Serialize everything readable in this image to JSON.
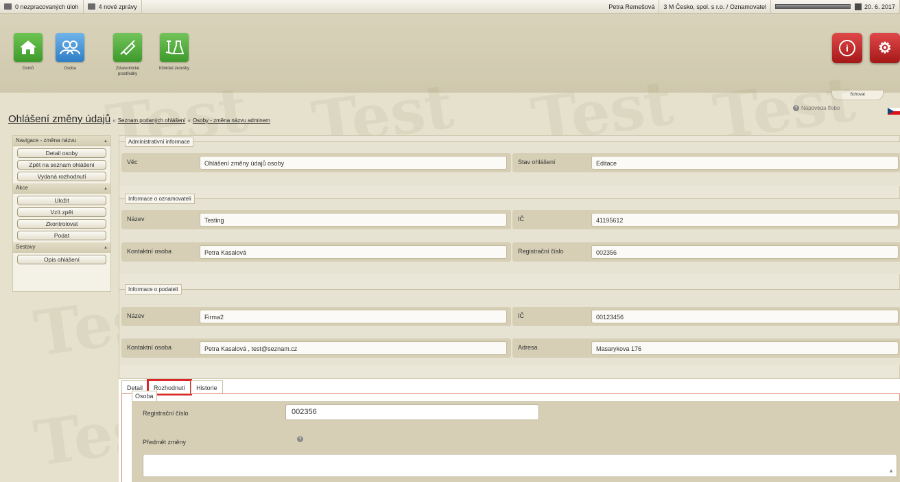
{
  "topbar": {
    "tasks": "0 nezpracovaných úloh",
    "messages": "4 nové zprávy",
    "user": "Petra Remešová",
    "org": "3 M Česko, spol. s r.o. / Oznamovatel",
    "date": "20. 6. 2017"
  },
  "header": {
    "nav": [
      {
        "label": "Domů",
        "icon": "home-icon",
        "color": "#4fae3b"
      },
      {
        "label": "Osoba",
        "icon": "people-icon",
        "color": "#3d8fd6"
      },
      {
        "label": "Zdravotnické prostředky",
        "icon": "syringe-icon",
        "color": "#5cb33c"
      },
      {
        "label": "Klinické zkoušky",
        "icon": "flask-icon",
        "color": "#5cb33c"
      }
    ],
    "hide_label": "Schovat",
    "info_symbol": "i",
    "settings_symbol": "⚙"
  },
  "watermark": "Test",
  "breadcrumb": {
    "title": "Ohlášení změny údajů",
    "sep": "«",
    "link1": "Seznam podaných ohlášení",
    "link2": "Osoby - změna názvu adminem"
  },
  "help": {
    "label": "Nápověda ffebo"
  },
  "sidebar": {
    "sections": [
      {
        "title": "Navigace - změna názvu",
        "items": [
          "Detail osoby",
          "Zpět na seznam ohlášení",
          "Vydaná rozhodnutí"
        ]
      },
      {
        "title": "Akce",
        "items": [
          "Uložit",
          "Vzít zpět",
          "Zkontrolovat",
          "Podat"
        ]
      },
      {
        "title": "Sestavy",
        "items": [
          "Opis ohlášení"
        ]
      }
    ]
  },
  "admin": {
    "legend": "Administrativní informace",
    "vec_label": "Věc",
    "vec_value": "Ohlášení změny údajů osoby",
    "stav_label": "Stav ohlášení",
    "stav_value": "Editace"
  },
  "oznamovatel": {
    "legend": "Informace o oznamovateli",
    "nazev_label": "Název",
    "nazev_value": "Testing",
    "ic_label": "IČ",
    "ic_value": "41195612",
    "kontakt_label": "Kontaktní osoba",
    "kontakt_value": "Petra Kasalová",
    "reg_label": "Registrační číslo",
    "reg_value": "002356"
  },
  "podatel": {
    "legend": "Informace o podateli",
    "nazev_label": "Název",
    "nazev_value": "Firma2",
    "ic_label": "IČ",
    "ic_value": "00123456",
    "kontakt_label": "Kontaktní osoba",
    "kontakt_value": "Petra Kasalová , test@seznam.cz",
    "adresa_label": "Adresa",
    "adresa_value": "Masarykova 176"
  },
  "tabs": [
    "Detail",
    "Rozhodnutí",
    "Historie"
  ],
  "osoba": {
    "legend": "Osoba",
    "reg_label": "Registrační číslo",
    "reg_value": "002356",
    "predmet_label": "Předmět změny"
  }
}
